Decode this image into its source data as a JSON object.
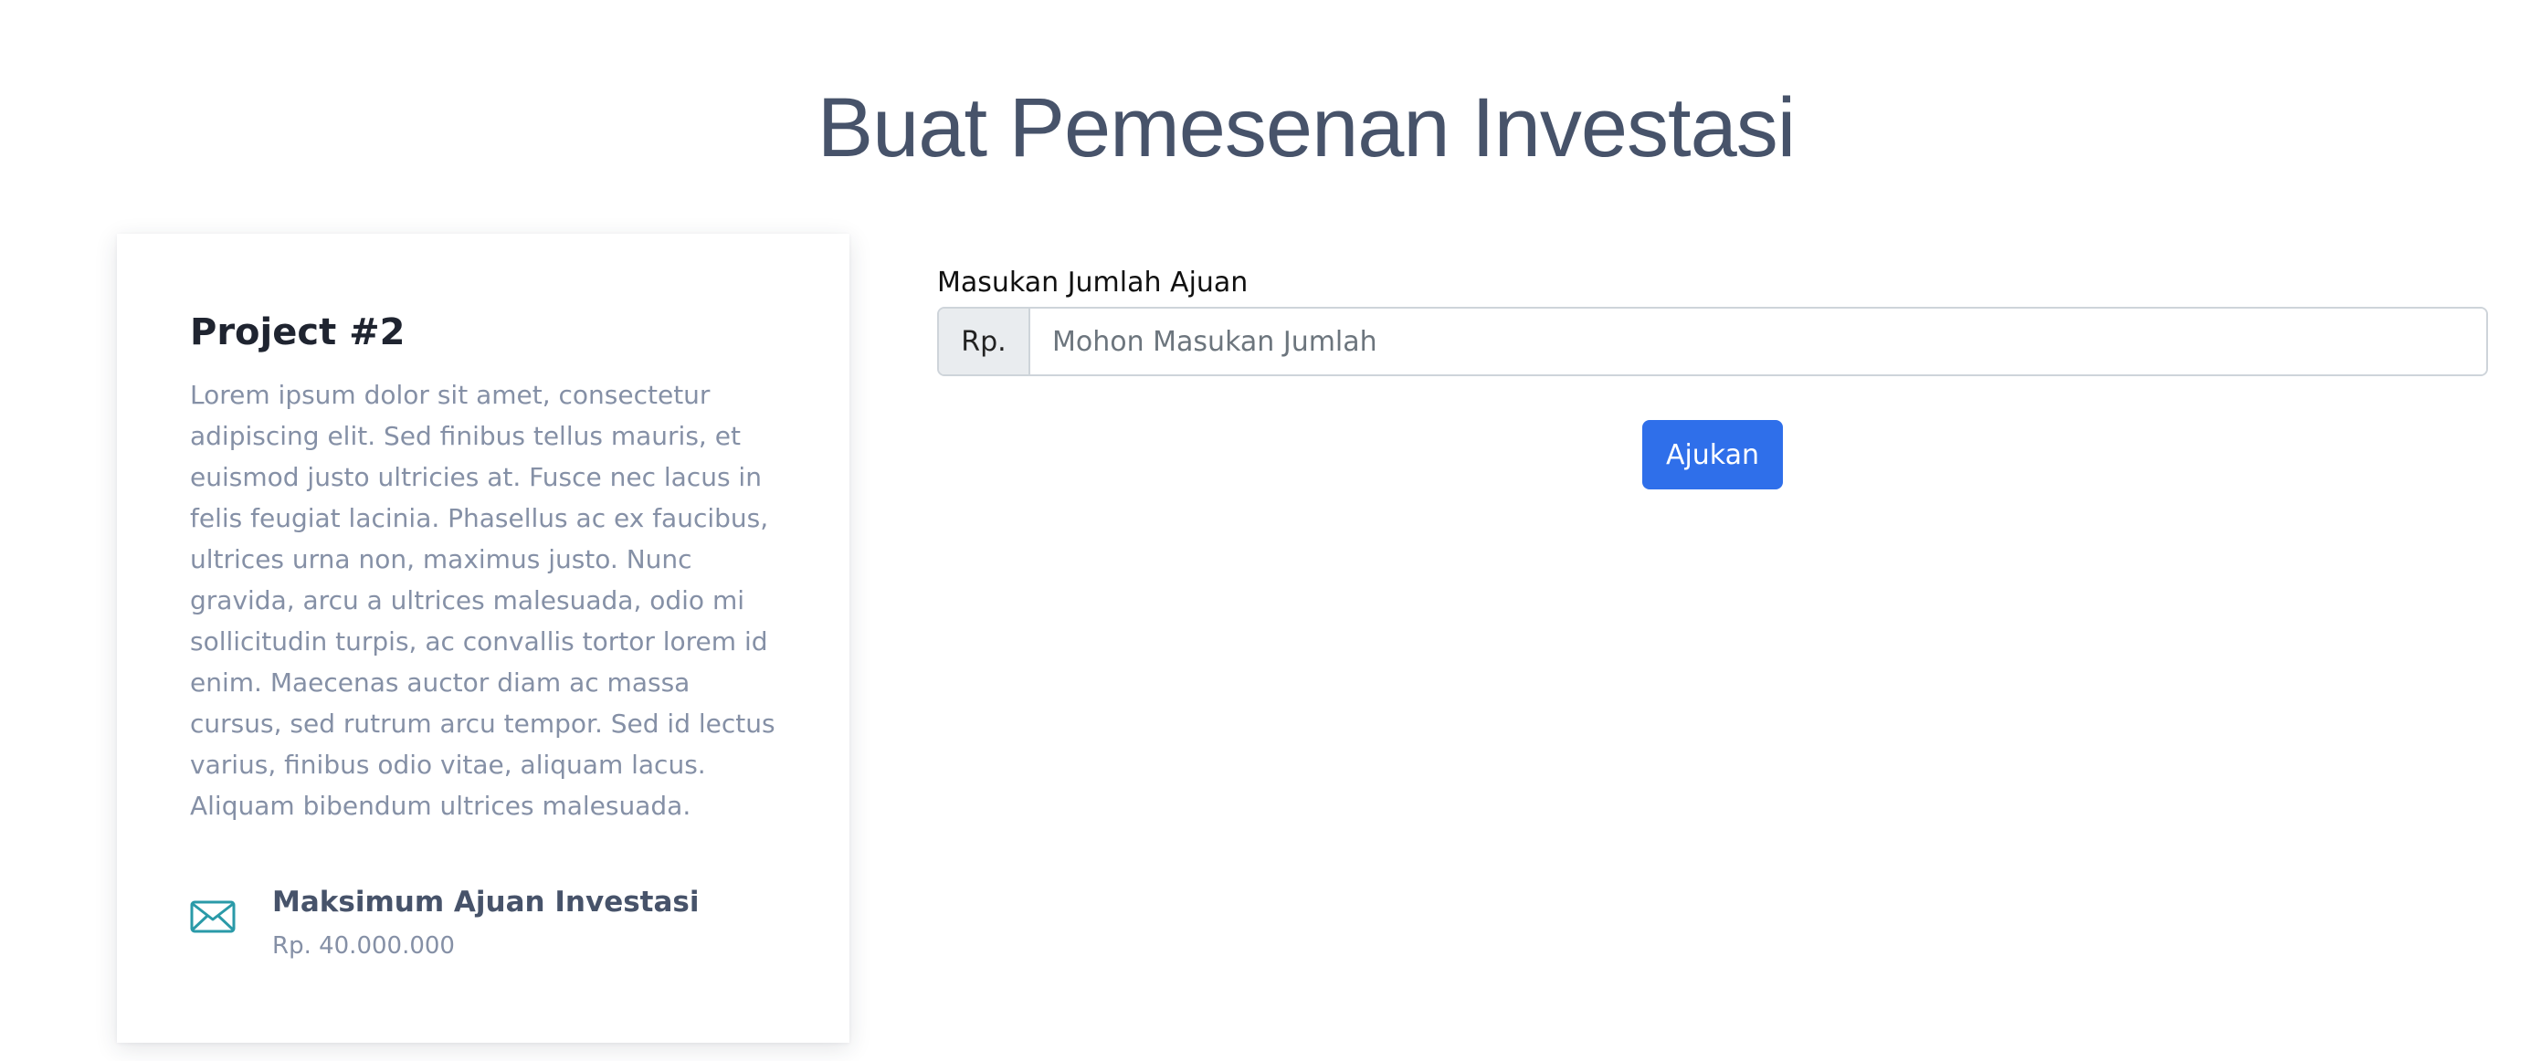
{
  "page": {
    "title": "Buat Pemesenan Investasi"
  },
  "project_card": {
    "title": "Project #2",
    "description": "Lorem ipsum dolor sit amet, consectetur adipiscing elit. Sed finibus tellus mauris, et euismod justo ultricies at. Fusce nec lacus in felis feugiat lacinia. Phasellus ac ex faucibus, ultrices urna non, maximus justo. Nunc gravida, arcu a ultrices malesuada, odio mi sollicitudin turpis, ac convallis tortor lorem id enim. Maecenas auctor diam ac massa cursus, sed rutrum arcu tempor. Sed id lectus varius, finibus odio vitae, aliquam lacus. Aliquam bibendum ultrices malesuada.",
    "max_investment": {
      "icon": "envelope-icon",
      "label": "Maksimum Ajuan Investasi",
      "value": "Rp. 40.000.000"
    }
  },
  "form": {
    "amount_label": "Masukan Jumlah Ajuan",
    "currency_prefix": "Rp.",
    "amount_placeholder": "Mohon Masukan Jumlah",
    "amount_value": "",
    "submit_label": "Ajukan"
  },
  "colors": {
    "accent": "#2f6fea",
    "icon": "#2a9aa8",
    "title_text": "#47536a",
    "muted_text": "#8590a6"
  }
}
